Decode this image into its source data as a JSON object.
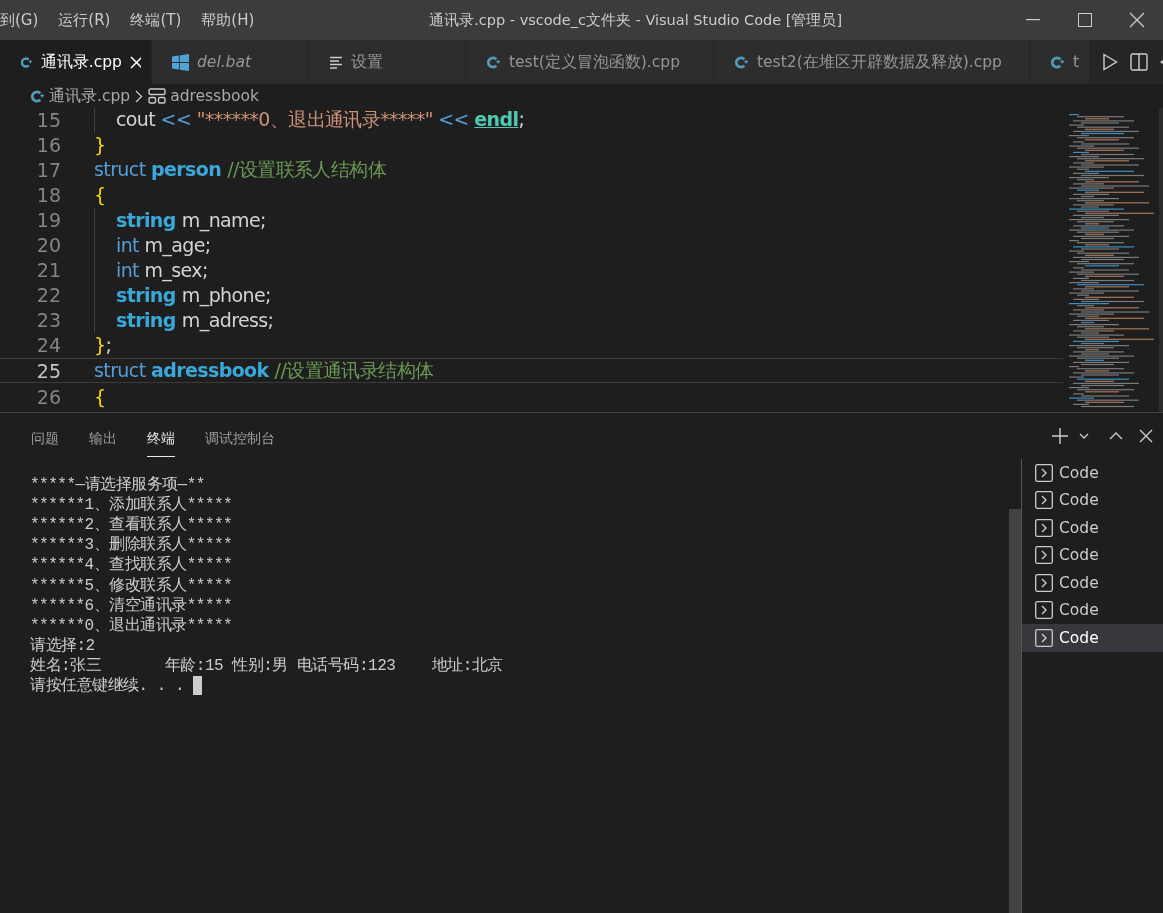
{
  "menu": [
    {
      "label": "到(G)"
    },
    {
      "label": "运行(R)"
    },
    {
      "label": "终端(T)"
    },
    {
      "label": "帮助(H)"
    }
  ],
  "window": {
    "title": "通讯录.cpp - vscode_c文件夹 - Visual Studio Code [管理员]"
  },
  "tabs": [
    {
      "label": "通讯录.cpp",
      "kind": "cpp",
      "selected": true,
      "preview": false
    },
    {
      "label": "del.bat",
      "kind": "windows",
      "selected": false,
      "preview": true
    },
    {
      "label": "设置",
      "kind": "settings",
      "selected": false,
      "preview": false
    },
    {
      "label": "test(定义冒泡函数).cpp",
      "kind": "cpp",
      "selected": false,
      "preview": false
    },
    {
      "label": "test2(在堆区开辟数据及释放).cpp",
      "kind": "cpp",
      "selected": false,
      "preview": false
    },
    {
      "label": "t",
      "kind": "cpp",
      "selected": false,
      "preview": false
    }
  ],
  "breadcrumb": [
    {
      "label": "通讯录.cpp",
      "kind": "cpp"
    },
    {
      "label": "adressbook",
      "kind": "struct"
    }
  ],
  "code": [
    {
      "number": "15",
      "indented": true,
      "current": false,
      "tokens": [
        {
          "t": "cout ",
          "kind": "plain"
        },
        {
          "t": "<< ",
          "kind": "op"
        },
        {
          "t": "\"******0、退出通讯录*****\" ",
          "kind": "string"
        },
        {
          "t": "<< ",
          "kind": "op"
        },
        {
          "t": "endl",
          "kind": "func"
        },
        {
          "t": ";",
          "kind": "plain"
        }
      ]
    },
    {
      "number": "16",
      "indented": false,
      "current": false,
      "tokens": [
        {
          "t": "}",
          "kind": "bracket"
        }
      ]
    },
    {
      "number": "17",
      "indented": false,
      "current": false,
      "tokens": [
        {
          "t": "struct ",
          "kind": "keyword"
        },
        {
          "t": "person ",
          "kind": "type"
        },
        {
          "t": "//设置联系人结构体",
          "kind": "comment"
        }
      ]
    },
    {
      "number": "18",
      "indented": false,
      "current": false,
      "tokens": [
        {
          "t": "{",
          "kind": "bracket"
        }
      ]
    },
    {
      "number": "19",
      "indented": true,
      "current": false,
      "tokens": [
        {
          "t": "string ",
          "kind": "type"
        },
        {
          "t": "m_name;",
          "kind": "plain"
        }
      ]
    },
    {
      "number": "20",
      "indented": true,
      "current": false,
      "tokens": [
        {
          "t": "int ",
          "kind": "keyword"
        },
        {
          "t": "m_age;",
          "kind": "plain"
        }
      ]
    },
    {
      "number": "21",
      "indented": true,
      "current": false,
      "tokens": [
        {
          "t": "int ",
          "kind": "keyword"
        },
        {
          "t": "m_sex;",
          "kind": "plain"
        }
      ]
    },
    {
      "number": "22",
      "indented": true,
      "current": false,
      "tokens": [
        {
          "t": "string ",
          "kind": "type"
        },
        {
          "t": "m_phone;",
          "kind": "plain"
        }
      ]
    },
    {
      "number": "23",
      "indented": true,
      "current": false,
      "tokens": [
        {
          "t": "string ",
          "kind": "type"
        },
        {
          "t": "m_adress;",
          "kind": "plain"
        }
      ]
    },
    {
      "number": "24",
      "indented": false,
      "current": false,
      "tokens": [
        {
          "t": "}",
          "kind": "bracket"
        },
        {
          "t": ";",
          "kind": "plain"
        }
      ]
    },
    {
      "number": "25",
      "indented": false,
      "current": true,
      "tokens": [
        {
          "t": "struct ",
          "kind": "keyword"
        },
        {
          "t": "adressbook ",
          "kind": "type"
        },
        {
          "t": "//设置通讯录结构体",
          "kind": "comment"
        }
      ]
    },
    {
      "number": "26",
      "indented": false,
      "current": false,
      "tokens": [
        {
          "t": "{",
          "kind": "bracket"
        }
      ]
    }
  ],
  "panel": {
    "tabs": [
      {
        "label": "问题",
        "selected": false
      },
      {
        "label": "输出",
        "selected": false
      },
      {
        "label": "终端",
        "selected": true
      },
      {
        "label": "调试控制台",
        "selected": false
      }
    ],
    "terminal_lines": [
      "*****—请选择服务项—**",
      "******1、添加联系人*****",
      "******2、查看联系人*****",
      "******3、删除联系人*****",
      "******4、查找联系人*****",
      "******5、修改联系人*****",
      "******6、清空通讯录*****",
      "******0、退出通讯录*****",
      "请选择:2",
      "姓名:张三       年龄:15 性别:男 电话号码:123    地址:北京",
      "请按任意键继续. . . "
    ],
    "terminals": [
      {
        "label": "Code",
        "selected": false
      },
      {
        "label": "Code",
        "selected": false
      },
      {
        "label": "Code",
        "selected": false
      },
      {
        "label": "Code",
        "selected": false
      },
      {
        "label": "Code",
        "selected": false
      },
      {
        "label": "Code",
        "selected": false
      },
      {
        "label": "Code",
        "selected": true
      }
    ]
  }
}
